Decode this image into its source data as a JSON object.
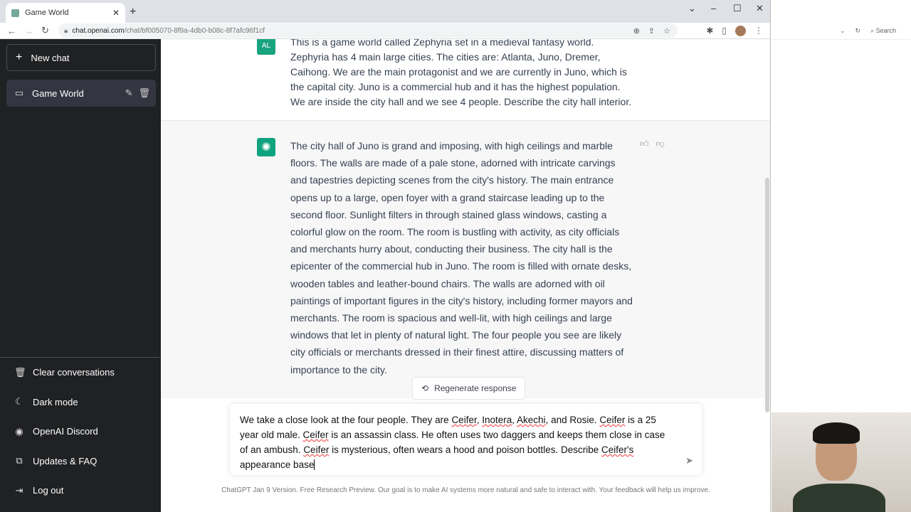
{
  "browser": {
    "tab_title": "Game World",
    "url_domain": "chat.openai.com",
    "url_path": "/chat/bf005070-8f9a-4db0-b08c-8f7afc96f1cf"
  },
  "sidebar": {
    "new_chat": "New chat",
    "conversations": [
      {
        "title": "Game World"
      }
    ],
    "bottom_items": [
      {
        "label": "Clear conversations",
        "icon": "trash-icon"
      },
      {
        "label": "Dark mode",
        "icon": "moon-icon"
      },
      {
        "label": "OpenAI Discord",
        "icon": "discord-icon"
      },
      {
        "label": "Updates & FAQ",
        "icon": "external-link-icon"
      },
      {
        "label": "Log out",
        "icon": "logout-icon"
      }
    ]
  },
  "messages": [
    {
      "role": "user",
      "avatar": "AL",
      "avatar_color": "#1aa37f",
      "text": "This is a game world called Zephyria set in a medieval fantasy world. Zephyria has 4 main large cities. The cities are: Atlanta, Juno, Dremer, Caihong. We are the main protagonist and we are currently in Juno, which is the capital city. Juno is a commercial hub and it has the highest population. We are inside the city hall and we see 4 people. Describe the city hall interior."
    },
    {
      "role": "assistant",
      "avatar_color": "#10a37f",
      "text": "The city hall of Juno is grand and imposing, with high ceilings and marble floors. The walls are made of a pale stone, adorned with intricate carvings and tapestries depicting scenes from the city's history. The main entrance opens up to a large, open foyer with a grand staircase leading up to the second floor. Sunlight filters in through stained glass windows, casting a colorful glow on the room. The room is bustling with activity, as city officials and merchants hurry about, conducting their business. The city hall is the epicenter of the commercial hub in Juno. The room is filled with ornate desks, wooden tables and leather-bound chairs. The walls are adorned with oil paintings of important figures in the city's history, including former mayors and merchants. The room is spacious and well-lit, with high ceilings and large windows that let in plenty of natural light. The four people you see are likely city officials or merchants dressed in their finest attire, discussing matters of importance to the city."
    }
  ],
  "regenerate_label": "Regenerate response",
  "input": {
    "parts": [
      "We take a close look at the four people. They are ",
      "Ceifer",
      ", ",
      "Inotera",
      ", ",
      "Akechi",
      ", and Rosie. ",
      "Ceifer",
      " is a 25 year old male. ",
      "Ceifer",
      " is an assassin class. He often uses two daggers and keeps them close in case of an ambush. ",
      "Ceifer",
      " is mysterious, often wears a hood and poison bottles. Describe ",
      "Ceifer's",
      " appearance base"
    ]
  },
  "footer": {
    "link": "ChatGPT Jan 9 Version",
    "text": ". Free Research Preview. Our goal is to make AI systems more natural and safe to interact with. Your feedback will help us improve."
  },
  "second_window": {
    "search_placeholder": "Search"
  }
}
